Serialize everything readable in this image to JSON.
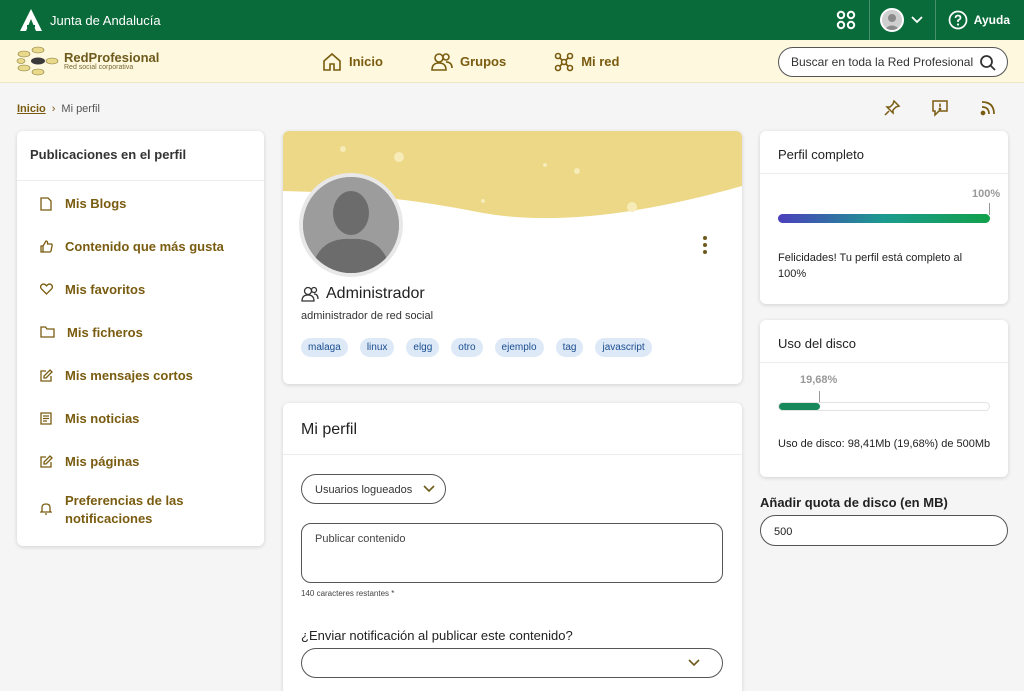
{
  "topbar": {
    "brand": "Junta de Andalucía",
    "help": "Ayuda",
    "color": "#0a6b3a"
  },
  "navbar": {
    "logo_name": "RedProfesional",
    "logo_sub": "Red social corporativa",
    "items": [
      {
        "label": "Inicio",
        "icon": "home-icon"
      },
      {
        "label": "Grupos",
        "icon": "group-icon"
      },
      {
        "label": "Mi red",
        "icon": "network-icon"
      }
    ],
    "search_placeholder": "Buscar en toda la Red Profesional"
  },
  "breadcrumb": {
    "home": "Inicio",
    "current": "Mi perfil"
  },
  "left": {
    "title": "Publicaciones en el perfil",
    "items": [
      {
        "label": "Mis Blogs",
        "icon": "document-icon"
      },
      {
        "label": "Contenido que más gusta",
        "icon": "thumbs-up-icon"
      },
      {
        "label": "Mis favoritos",
        "icon": "heart-icon"
      },
      {
        "label": "Mis ficheros",
        "icon": "folder-icon"
      },
      {
        "label": "Mis mensajes cortos",
        "icon": "edit-icon"
      },
      {
        "label": "Mis noticias",
        "icon": "news-icon"
      },
      {
        "label": "Mis páginas",
        "icon": "edit-icon"
      },
      {
        "label": "Preferencias de las notificaciones",
        "icon": "bell-icon"
      }
    ]
  },
  "profile": {
    "name": "Administrador",
    "role": "administrador de red social",
    "tags": [
      "malaga",
      "linux",
      "elgg",
      "otro",
      "ejemplo",
      "tag",
      "javascript"
    ]
  },
  "miperfil": {
    "title": "Mi perfil",
    "visibility": "Usuarios logueados",
    "textarea_placeholder": "Publicar contenido",
    "remaining": "140 caracteres restantes *",
    "notify_question": "¿Enviar notificación al publicar este contenido?"
  },
  "perfil_completo": {
    "title": "Perfil completo",
    "percent_label": "100%",
    "percent": 100,
    "message": "Felicidades! Tu perfil está completo al 100%"
  },
  "disco": {
    "title": "Uso del disco",
    "percent_label": "19,68%",
    "percent": 19.68,
    "message": "Uso de disco: 98,41Mb (19,68%) de 500Mb"
  },
  "quota": {
    "label": "Añadir quota de disco (en MB)",
    "value": "500"
  }
}
